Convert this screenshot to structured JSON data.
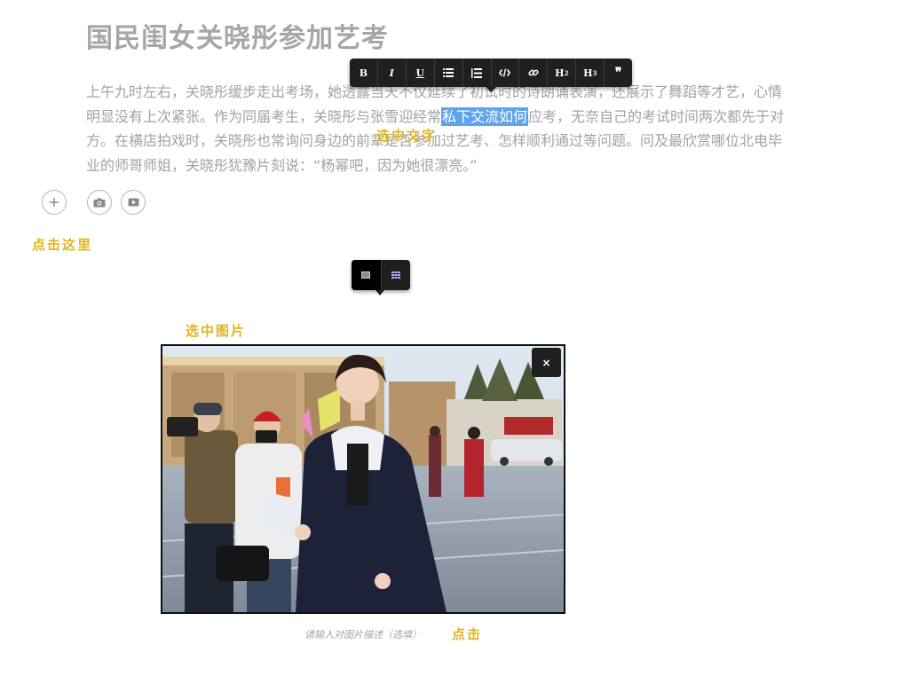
{
  "article": {
    "title": "国民闺女关晓彤参加艺考",
    "paragraph_before": "上午九时左右，关晓彤缓步走出考场，她透露当天不仅延续了初试时的诗朗诵表演，还展示了舞蹈等才艺，心情明显没有上次紧张。作为同届考生，关晓彤与张雪迎经常",
    "paragraph_selected": "私下交流如何",
    "paragraph_after": "应考，无奈自己的考试时间两次都先于对方。在横店拍戏时，关晓彤也常询问身边的前辈是否参加过艺考、怎样顺利通过等问题。问及最欣赏哪位北电毕业的师哥师姐，关晓彤犹豫片刻说：“杨幂吧，因为她很漂亮。”"
  },
  "format_toolbar": {
    "bold": "B",
    "italic": "I",
    "underline": "U",
    "h2": "H",
    "h2_sup": "2",
    "h3": "H",
    "h3_sup": "3",
    "quote": "❞"
  },
  "annotations": {
    "select_text": "选中文字",
    "click_here": "点击这里",
    "select_image": "选中图片",
    "click": "点击"
  },
  "insert_buttons": {
    "add_icon": "plus-icon",
    "photo_icon": "camera-icon",
    "video_icon": "video-icon"
  },
  "image": {
    "close_label": "×",
    "caption_placeholder": "请输入对图片描述（选填）"
  },
  "colors": {
    "highlight": "#5fa3ef",
    "annotation": "#e3b31e",
    "toolbar": "#1f1f1f"
  }
}
